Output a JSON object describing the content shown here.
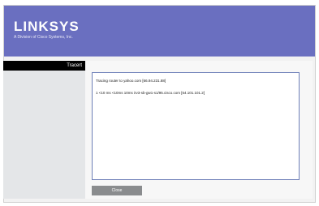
{
  "brand": {
    "name": "Linksys",
    "subtitle": "A Division of Cisco Systems, Inc.",
    "header_color": "#6a6fc0"
  },
  "section": {
    "title": "Tracert"
  },
  "output": {
    "lines": [
      "Tracing router to yahoo.com [66.94.231.88]",
      "1   <10 ms   <10ms   10ms   irv3-sb-gw1-s1/95.cisco.com [64.101.101.2]"
    ]
  },
  "actions": {
    "close_label": "Close"
  }
}
